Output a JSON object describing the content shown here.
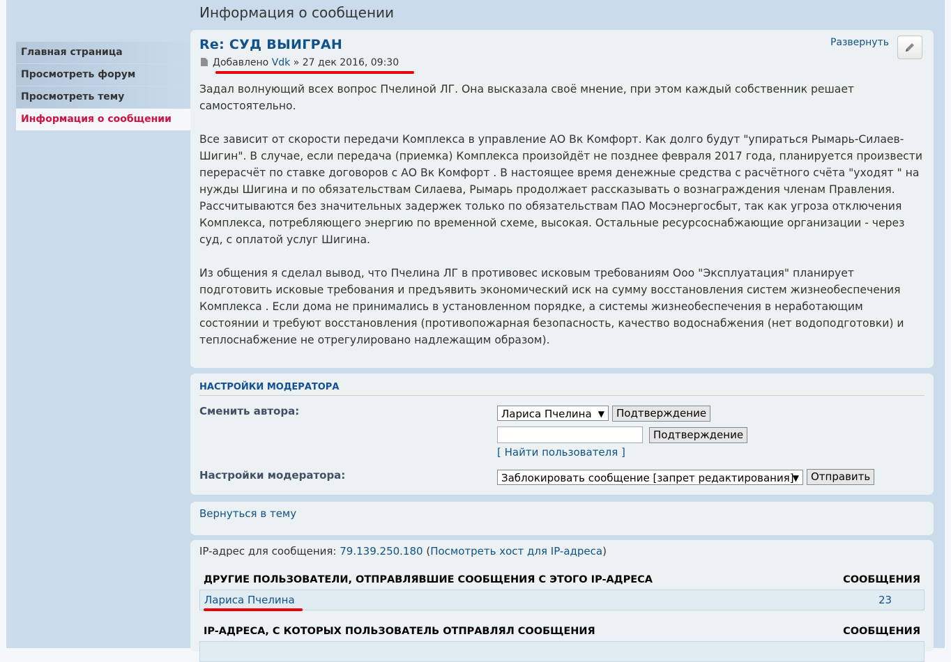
{
  "page": {
    "heading": "Информация о сообщении"
  },
  "menu": [
    {
      "label": "Главная страница",
      "active": false
    },
    {
      "label": "Просмотреть форум",
      "active": false
    },
    {
      "label": "Просмотреть тему",
      "active": false
    },
    {
      "label": "Информация о сообщении",
      "active": true
    }
  ],
  "post": {
    "title": "Re: СУД ВЫИГРАН",
    "meta_prefix": "Добавлено",
    "author": "Vdk",
    "separator": "»",
    "date": "27 дек 2016, 09:30",
    "expand_label": "Развернуть",
    "edit_icon": "pencil-icon",
    "paragraphs": [
      "Задал волнующий всех вопрос Пчелиной ЛГ. Она высказала своё мнение, при этом каждый собственник решает самостоятельно.",
      "Все зависит от скорости передачи Комплекса в управление АО Вк Комфорт. Как долго будут \"упираться Рымарь-Силаев-Шигин\". В случае, если передача (приемка) Комплекса произойдёт не позднее февраля 2017 года, планируется произвести перерасчёт по ставке договоров с АО Вк Комфорт . В настоящее время денежные средства с расчётного счёта \"уходят \" на нужды Шигина и по обязательствам Силаева, Рымарь продолжает рассказывать о вознаграждения членам Правления. Рассчитываются без значительных задержек только по обязательствам ПАО Мосэнергосбыт, так как угроза отключения Комплекса, потребляющего энергию по временной схеме, высокая. Остальные ресурсоснабжающие организации - через суд, с оплатой услуг Шигина.",
      "Из общения я сделал вывод, что Пчелина ЛГ в противовес исковым требованиям Ооо \"Эксплуатация\" планирует подготовить исковые требования и предъявить экономический иск на сумму восстановления систем жизнеобеспечения Комплекса . Если дома не принимались в установленном порядке, а системы жизнеобеспечения в неработающим состоянии и требуют восстановления (противопожарная безопасность, качество водоснабжения (нет водоподготовки) и теплоснабжение не отрегулировано надлежащим образом)."
    ]
  },
  "moderator": {
    "title": "Настройки модератора",
    "change_author_label": "Сменить автора:",
    "author_select_value": "Лариса Пчелина",
    "confirm_label": "Подтверждение",
    "username_input_value": "",
    "find_user_label": "[ Найти пользователя ]",
    "mod_options_label": "Настройки модератора:",
    "mod_select_value": "Заблокировать сообщение [запрет редактирования]",
    "submit_label": "Отправить"
  },
  "return_link": "Вернуться в тему",
  "ip": {
    "prefix": "IP-адрес для сообщения:",
    "address": "79.139.250.180",
    "open_paren": "(",
    "host_link": "Посмотреть хост для IP-адреса",
    "close_paren": ")",
    "other_users_header": "Другие пользователи, отправлявшие сообщения с этого IP-адреса",
    "posts_header": "Сообщения",
    "other_users": [
      {
        "name": "Лариса Пчелина",
        "posts": "23"
      }
    ],
    "user_ips_header": "IP-адреса, с которых пользователь отправлял сообщения"
  },
  "colors": {
    "accent": "#105289",
    "active_menu": "#d31141",
    "annotation": "#e8000b"
  }
}
